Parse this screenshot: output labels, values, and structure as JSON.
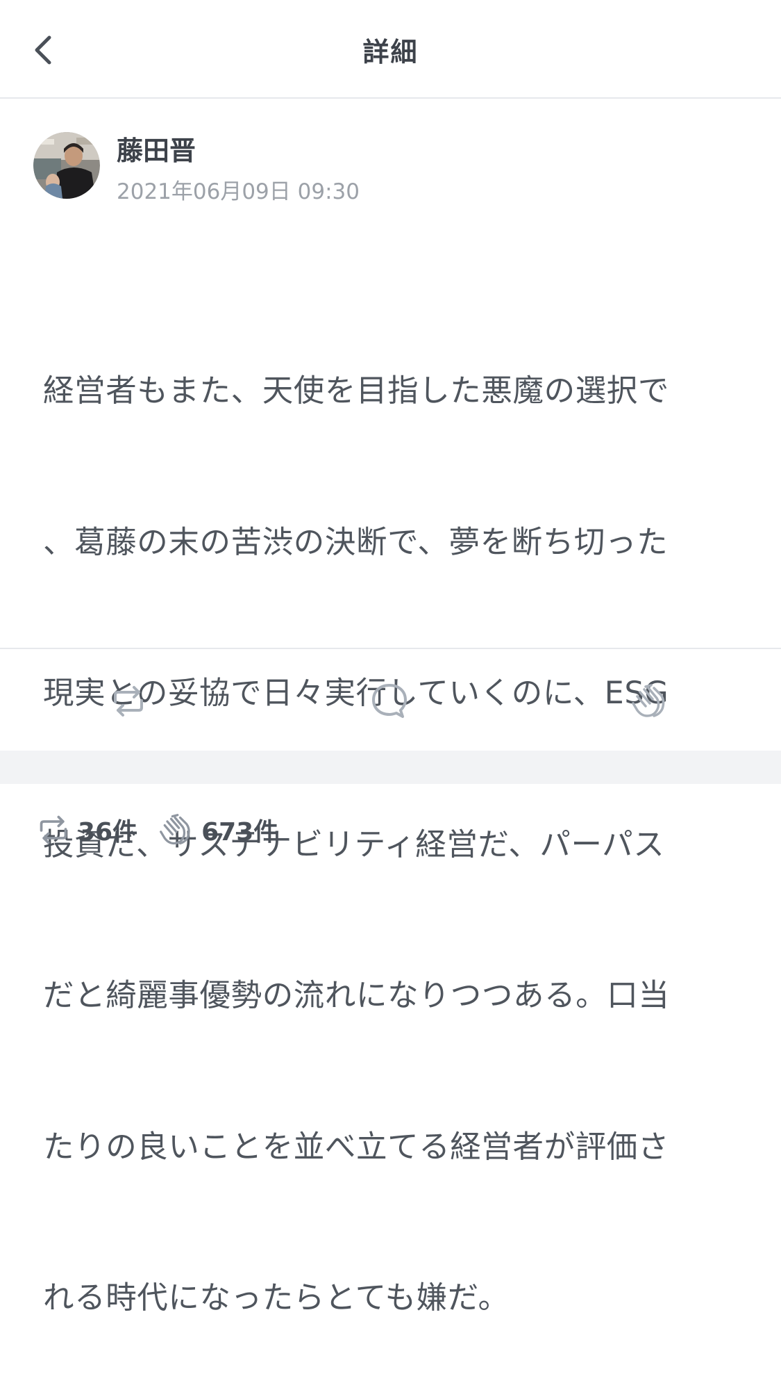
{
  "header": {
    "back_icon": "chevron-left-icon",
    "title": "詳細"
  },
  "post": {
    "author": {
      "name": "藤田晋",
      "avatar_icon": "avatar-photo"
    },
    "timestamp": "2021年06月09日 09:30",
    "lines": [
      "経営者もまた、天使を目指した悪魔の選択で",
      "、葛藤の末の苦渋の決断で、夢を断ち切った",
      "現実との妥協で日々実行していくのに、ESG",
      "投資だ、サステナビリティ経営だ、パーパス",
      "だと綺麗事優勢の流れになりつつある。口当",
      "たりの良いことを並べ立てる経営者が評価さ",
      "れる時代になったらとても嫌だ。"
    ]
  },
  "actions": [
    {
      "name": "repost",
      "icon": "repost-icon"
    },
    {
      "name": "comment",
      "icon": "comment-icon"
    },
    {
      "name": "clap",
      "icon": "clap-icon"
    }
  ],
  "stats": {
    "reposts": "36件",
    "claps": "673件"
  },
  "colors": {
    "text": "#4f555d",
    "muted": "#9ca1a8",
    "icon": "#a9b0b9",
    "divider": "#e6e8ec",
    "band": "#f2f3f5"
  }
}
